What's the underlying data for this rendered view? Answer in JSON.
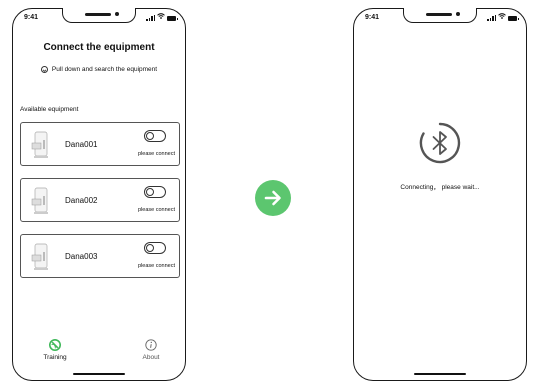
{
  "status_bar": {
    "time": "9:41"
  },
  "left_screen": {
    "title": "Connect the equipment",
    "pull_hint": "Pull down and search the equipment",
    "section_label": "Available equipment",
    "devices": [
      {
        "name": "Dana001",
        "action": "please connect",
        "connected": false
      },
      {
        "name": "Dana002",
        "action": "please connect",
        "connected": false
      },
      {
        "name": "Dana003",
        "action": "please connect",
        "connected": false
      }
    ],
    "tabs": [
      {
        "label": "Training",
        "icon": "training-icon",
        "active": true
      },
      {
        "label": "About",
        "icon": "info-icon",
        "active": false
      }
    ]
  },
  "transition": {
    "icon": "arrow-right-icon",
    "color": "#5cc66f"
  },
  "right_screen": {
    "icon": "bluetooth-icon",
    "status": "Connecting， please wait..."
  },
  "colors": {
    "accent": "#5cc66f",
    "stroke": "#1a1a1a"
  }
}
